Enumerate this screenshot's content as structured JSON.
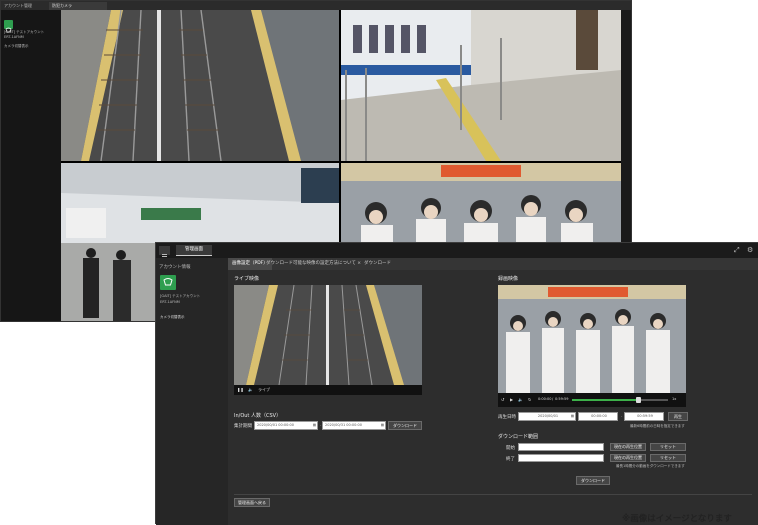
{
  "back_window": {
    "app_title": "アカウント管理",
    "tab_label": "防犯カメラ",
    "sidebar": {
      "account_line1": "[GAIT] テストアカウント",
      "account_line2": "ERT-1AFNM",
      "menu_item": "カメラ切替表示"
    }
  },
  "front_window": {
    "top_tab_label": "管理画面",
    "sidebar": {
      "section_label": "アカウント情報",
      "account_line1": "[GAIT] テストアカウント",
      "account_line2": "ERT-1AFNM",
      "menu_item": "カメラ切替表示"
    },
    "tabs": [
      {
        "label": "画像設定（PDF）",
        "active": true
      },
      {
        "label": "ダウンロード可能な映像の設定方法について ×",
        "active": false
      },
      {
        "label": "ダウンロード",
        "active": false
      }
    ],
    "live": {
      "title": "ライブ映像",
      "mode_label": "ライブ"
    },
    "inout": {
      "title": "In/Out 人数（CSV）",
      "period_label": "集計期間",
      "start_value": "2020/00/01 00:00:00",
      "end_value": "2020/00/31 00:00:00",
      "download_button": "ダウンロード"
    },
    "recorded": {
      "title": "録画映像",
      "time_current": "0:00:00",
      "time_total": "0:59:59",
      "speed": "1x"
    },
    "playback": {
      "label": "再生日時",
      "date_value": "2020/00/01",
      "time_from": "00:00:00",
      "time_to": "00:59:59",
      "play_button": "再生",
      "note": "最新6時間前の日時を指定できます"
    },
    "download_section": {
      "title": "ダウンロード範囲",
      "start_label": "開始",
      "end_label": "終了",
      "set_current_start": "現在の再生位置",
      "set_current_end": "現在の再生位置",
      "reset_start": "リセット",
      "reset_end": "リセット",
      "note": "最長1時間分の動画をダウンロードできます",
      "download_button": "ダウンロード"
    },
    "back_button": "管理画面へ戻る"
  },
  "disclaimer": "※画像はイメージとなります",
  "colors": {
    "accent_green": "#2e9e4f",
    "dark_bg": "#2d2d2d",
    "timeline_green": "#3db14a"
  }
}
